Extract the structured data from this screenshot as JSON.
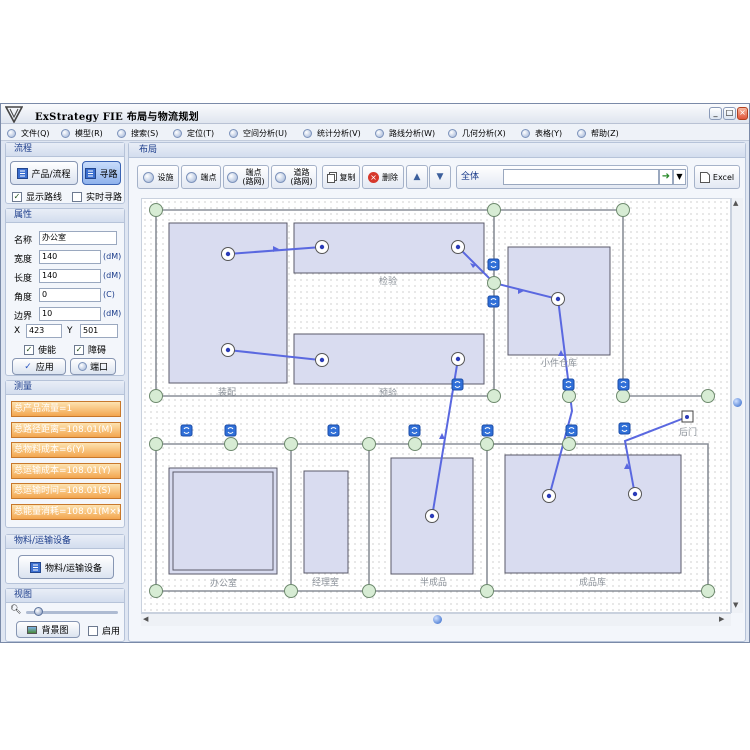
{
  "window": {
    "title": "ExStrategy FIE 布局与物流规划",
    "buttons": [
      "_",
      "□",
      "×"
    ]
  },
  "menu": [
    "文件(Q)",
    "模型(R)",
    "搜索(S)",
    "定位(T)",
    "空间分析(U)",
    "统计分析(V)",
    "路线分析(W)",
    "几何分析(X)",
    "表格(Y)",
    "帮助(Z)"
  ],
  "flow": {
    "header": "流程",
    "product_flow_button": "产品/流程",
    "find_path_button": "寻路",
    "show_route_label": "显示路线",
    "show_route_checked": true,
    "realtime_label": "实时寻路",
    "realtime_checked": false
  },
  "properties": {
    "header": "属性",
    "name_label": "名称",
    "name_value": "办公室",
    "width_label": "宽度",
    "width_value": "140",
    "width_unit": "(dM)",
    "length_label": "长度",
    "length_value": "140",
    "length_unit": "(dM)",
    "angle_label": "角度",
    "angle_value": "0",
    "angle_unit": "(C)",
    "border_label": "边界",
    "border_value": "10",
    "border_unit": "(dM)",
    "x_label": "X",
    "x_value": "423",
    "y_label": "Y",
    "y_value": "501",
    "enable_label": "使能",
    "enable_checked": true,
    "obstacle_label": "障碍",
    "obstacle_checked": true,
    "apply_button": "应用",
    "port_button": "端口"
  },
  "measure": {
    "header": "测量",
    "items": [
      "总产品流量=1",
      "总路径距离=108.01(M)",
      "总物料成本=6(Y)",
      "总运输成本=108.01(Y)",
      "总运输时间=108.01(S)",
      "总能量消耗=108.01(M×Kg)"
    ]
  },
  "material": {
    "header": "物料/运输设备",
    "button": "物料/运输设备"
  },
  "view": {
    "header": "视图",
    "bg_button": "背景图",
    "enable_label": "启用",
    "enable_checked": false
  },
  "layout": {
    "header": "布局",
    "tools": {
      "facility": "设施",
      "endpoint": "端点",
      "endpoint_road_line1": "端点",
      "endpoint_road_line2": "(路网)",
      "road_line1": "道路",
      "road_line2": "(路网)",
      "copy": "复制",
      "delete": "删除",
      "scope": "全体",
      "excel": "Excel"
    },
    "zones": {
      "assembly": "装配",
      "inspection": "检验",
      "prep": "预验",
      "small_parts": "小件仓库",
      "back_door": "后门",
      "office": "办公室",
      "manager": "经理室",
      "semi_finished": "半成品",
      "finished_goods": "成品库"
    }
  },
  "colors": {
    "zone_fill": "#d9dcf0",
    "zone_stroke": "#5a5a6a",
    "road": "#8a8f98",
    "node_fill": "#d7ecd4",
    "node_stroke": "#6e8a6e",
    "route": "#5a68e0",
    "measure_fill": "#f5b463",
    "accent": "#1a3b8a"
  }
}
